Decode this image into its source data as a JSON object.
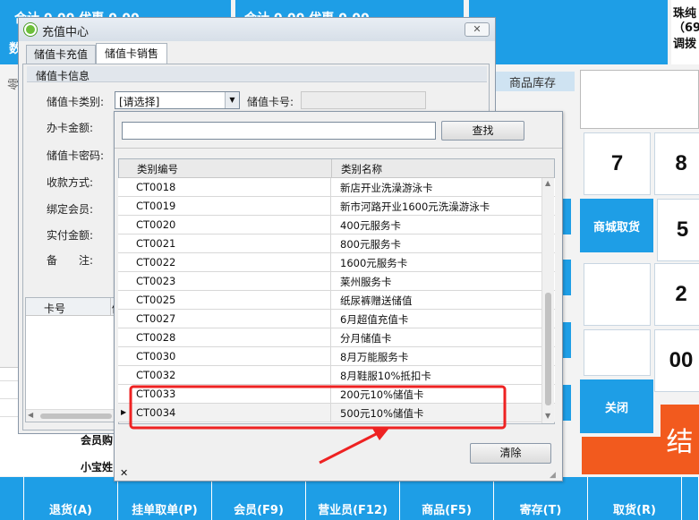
{
  "top": {
    "block1_line1": "合计 0.00 优惠 0.00",
    "block2_line1": "合计 0.00 优惠 0.00",
    "block1_line2_char": "数",
    "right_title": "珠纯",
    "right_sub": "（69",
    "right_line3": "调拨",
    "left_edge_char": "零",
    "stock_label": "商品库存"
  },
  "keypad": {
    "k7": "7",
    "k8": "8",
    "k5": "5",
    "k2": "2",
    "k00": "00",
    "settle": "结"
  },
  "side_buttons": {
    "mall": "商城取货",
    "close": "关闭"
  },
  "bottom_buttons": [
    "退货(A)",
    "挂单取单(P)",
    "会员(F9)",
    "营业员(F12)",
    "商品(F5)",
    "寄存(T)",
    "取货(R)"
  ],
  "background_left": {
    "member_text": "会员购",
    "baby_text": "小宝姓"
  },
  "dialog": {
    "title": "充值中心",
    "tab_recharge": "储值卡充值",
    "tab_sale": "储值卡销售",
    "group_title": "储值卡信息",
    "card_type_label": "储值卡类别:",
    "card_type_value": "[请选择]",
    "card_no_label": "储值卡号:",
    "amount_label": "办卡金额:",
    "password_label": "储值卡密码:",
    "pay_method_label": "收款方式:",
    "bind_member_label": "绑定会员:",
    "actual_pay_label": "实付金额:",
    "remark_label": "备　　注:",
    "list_col_card": "卡号",
    "list_col_i": "储"
  },
  "popup": {
    "search_placeholder": "",
    "search_button": "查找",
    "col_code": "类别编号",
    "col_name": "类别名称",
    "rows": [
      {
        "code": "CT0018",
        "name": "新店开业洗澡游泳卡"
      },
      {
        "code": "CT0019",
        "name": "新市河路开业1600元洗澡游泳卡"
      },
      {
        "code": "CT0020",
        "name": "400元服务卡"
      },
      {
        "code": "CT0021",
        "name": "800元服务卡"
      },
      {
        "code": "CT0022",
        "name": "1600元服务卡"
      },
      {
        "code": "CT0023",
        "name": "莱州服务卡"
      },
      {
        "code": "CT0025",
        "name": "纸尿裤赠送储值"
      },
      {
        "code": "CT0027",
        "name": "6月超值充值卡"
      },
      {
        "code": "CT0028",
        "name": "分月储值卡"
      },
      {
        "code": "CT0030",
        "name": "8月万能服务卡"
      },
      {
        "code": "CT0032",
        "name": "8月鞋服10%抵扣卡"
      },
      {
        "code": "CT0033",
        "name": "200元10%储值卡"
      },
      {
        "code": "CT0034",
        "name": "500元10%储值卡"
      }
    ],
    "clear_button": "清除",
    "close_x": "✕"
  },
  "colors": {
    "accent_blue": "#1e9ee6",
    "annotation_red": "#ee2222",
    "settle_orange": "#f25a1e"
  }
}
